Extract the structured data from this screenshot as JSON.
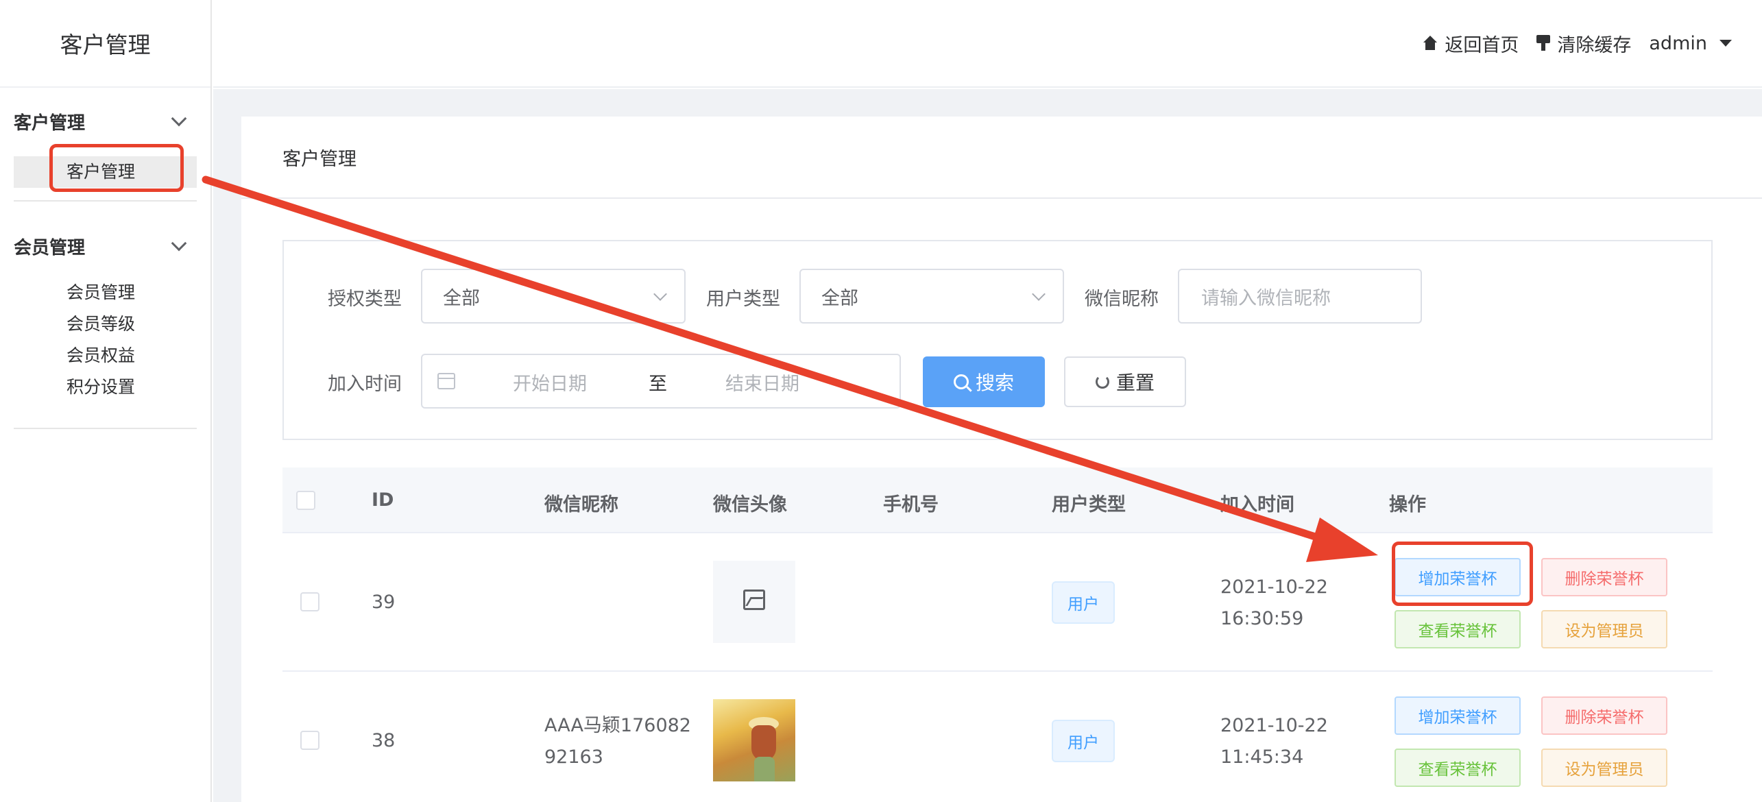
{
  "sidebar": {
    "logo": "客户管理",
    "groups": [
      {
        "title": "客户管理",
        "items": [
          "客户管理"
        ]
      },
      {
        "title": "会员管理",
        "items": [
          "会员管理",
          "会员等级",
          "会员权益",
          "积分设置"
        ]
      }
    ]
  },
  "header": {
    "home": "返回首页",
    "clear_cache": "清除缓存",
    "user": "admin"
  },
  "page": {
    "title": "客户管理"
  },
  "filter": {
    "auth_type_label": "授权类型",
    "auth_type_value": "全部",
    "user_type_label": "用户类型",
    "user_type_value": "全部",
    "nickname_label": "微信昵称",
    "nickname_placeholder": "请输入微信昵称",
    "join_time_label": "加入时间",
    "start_placeholder": "开始日期",
    "range_sep": "至",
    "end_placeholder": "结束日期",
    "search_button": "搜索",
    "reset_button": "重置"
  },
  "table": {
    "columns": [
      "ID",
      "微信昵称",
      "微信头像",
      "手机号",
      "用户类型",
      "加入时间",
      "操作"
    ],
    "rows": [
      {
        "id": "39",
        "nickname_line1": "",
        "nickname_line2": "",
        "phone": "",
        "user_type": "用户",
        "date": "2021-10-22",
        "time": "16:30:59"
      },
      {
        "id": "38",
        "nickname_line1": "AAA马颖176082",
        "nickname_line2": "92163",
        "phone": "",
        "user_type": "用户",
        "date": "2021-10-22",
        "time": "11:45:34"
      }
    ],
    "actions": {
      "add_cup": "增加荣誉杯",
      "delete_cup": "删除荣誉杯",
      "view_cup": "查看荣誉杯",
      "set_admin": "设为管理员"
    }
  },
  "colors": {
    "primary": "#409eff",
    "annotation": "#e8412c"
  }
}
